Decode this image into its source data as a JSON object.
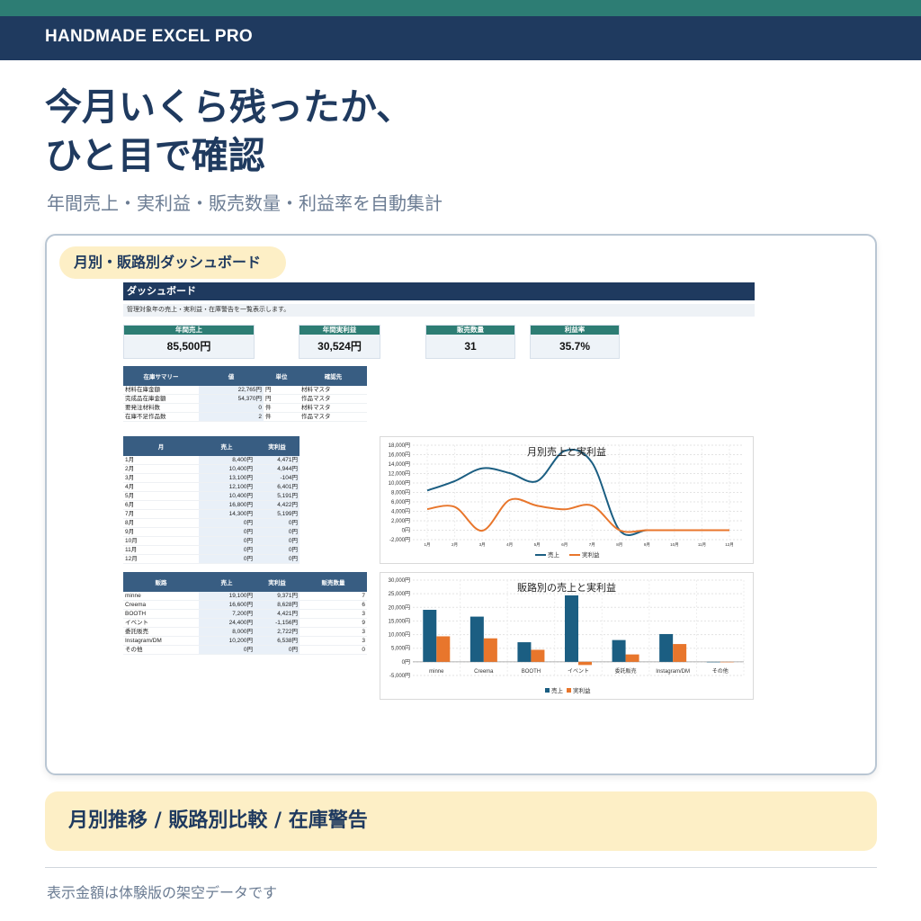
{
  "brand": "HANDMADE EXCEL PRO",
  "headline": [
    "今月いくら残ったか、",
    "ひと目で確認"
  ],
  "subline": "年間売上・実利益・販売数量・利益率を自動集計",
  "card_label": "月別・販路別ダッシュボード",
  "dashboard": {
    "title": "ダッシュボード",
    "description": "管理対象年の売上・実利益・在庫警告を一覧表示します。",
    "kpis": [
      {
        "label": "年間売上",
        "value": "85,500円"
      },
      {
        "label": "年間実利益",
        "value": "30,524円"
      },
      {
        "label": "販売数量",
        "value": "31"
      },
      {
        "label": "利益率",
        "value": "35.7%"
      }
    ],
    "inventory": {
      "headers": [
        "在庫サマリー",
        "値",
        "単位",
        "確認先"
      ],
      "rows": [
        [
          "材料在庫金額",
          "22,765円",
          "円",
          "材料マスタ"
        ],
        [
          "完成品在庫金額",
          "54,370円",
          "円",
          "作品マスタ"
        ],
        [
          "要発注材料数",
          "0",
          "件",
          "材料マスタ"
        ],
        [
          "在庫不足作品数",
          "2",
          "件",
          "作品マスタ"
        ]
      ]
    },
    "monthly": {
      "headers": [
        "月",
        "売上",
        "実利益"
      ],
      "rows": [
        [
          "1月",
          "8,400円",
          "4,471円"
        ],
        [
          "2月",
          "10,400円",
          "4,944円"
        ],
        [
          "3月",
          "13,100円",
          "-104円"
        ],
        [
          "4月",
          "12,100円",
          "6,401円"
        ],
        [
          "5月",
          "10,400円",
          "5,191円"
        ],
        [
          "6月",
          "16,800円",
          "4,422円"
        ],
        [
          "7月",
          "14,300円",
          "5,199円"
        ],
        [
          "8月",
          "0円",
          "0円"
        ],
        [
          "9月",
          "0円",
          "0円"
        ],
        [
          "10月",
          "0円",
          "0円"
        ],
        [
          "11月",
          "0円",
          "0円"
        ],
        [
          "12月",
          "0円",
          "0円"
        ]
      ]
    },
    "channels": {
      "headers": [
        "販路",
        "売上",
        "実利益",
        "販売数量"
      ],
      "rows": [
        [
          "minne",
          "19,100円",
          "9,371円",
          "7"
        ],
        [
          "Creema",
          "16,600円",
          "8,628円",
          "6"
        ],
        [
          "BOOTH",
          "7,200円",
          "4,421円",
          "3"
        ],
        [
          "イベント",
          "24,400円",
          "-1,156円",
          "9"
        ],
        [
          "委託販売",
          "8,000円",
          "2,722円",
          "3"
        ],
        [
          "Instagram/DM",
          "10,200円",
          "6,538円",
          "3"
        ],
        [
          "その他",
          "0円",
          "0円",
          "0"
        ]
      ]
    }
  },
  "chart_data": [
    {
      "type": "line",
      "title": "月別売上と実利益",
      "categories": [
        "1月",
        "2月",
        "3月",
        "4月",
        "5月",
        "6月",
        "7月",
        "8月",
        "9月",
        "10月",
        "11月",
        "12月"
      ],
      "series": [
        {
          "name": "売上",
          "values": [
            8400,
            10400,
            13100,
            12100,
            10400,
            16800,
            14300,
            0,
            0,
            0,
            0,
            0
          ]
        },
        {
          "name": "実利益",
          "values": [
            4471,
            4944,
            -104,
            6401,
            5191,
            4422,
            5199,
            0,
            0,
            0,
            0,
            0
          ]
        }
      ],
      "ylim": [
        -2000,
        18000
      ],
      "yticks": [
        "-2,000円",
        "0円",
        "2,000円",
        "4,000円",
        "6,000円",
        "8,000円",
        "10,000円",
        "12,000円",
        "14,000円",
        "16,000円",
        "18,000円"
      ],
      "legend": "bottom",
      "grid": true,
      "colors": [
        "#1b5e82",
        "#e8762c"
      ]
    },
    {
      "type": "bar",
      "title": "販路別の売上と実利益",
      "categories": [
        "minne",
        "Creema",
        "BOOTH",
        "イベント",
        "委託販売",
        "Instagram/DM",
        "その他"
      ],
      "series": [
        {
          "name": "売上",
          "values": [
            19100,
            16600,
            7200,
            24400,
            8000,
            10200,
            0
          ]
        },
        {
          "name": "実利益",
          "values": [
            9371,
            8628,
            4421,
            -1156,
            2722,
            6538,
            0
          ]
        }
      ],
      "ylim": [
        -5000,
        30000
      ],
      "yticks": [
        "-5,000円",
        "0円",
        "5,000円",
        "10,000円",
        "15,000円",
        "20,000円",
        "25,000円",
        "30,000円"
      ],
      "legend": "bottom",
      "grid": true,
      "colors": [
        "#1b5e82",
        "#e8762c"
      ]
    }
  ],
  "banner": "月別推移 / 販路別比較 / 在庫警告",
  "footnote": "表示金額は体験版の架空データです"
}
